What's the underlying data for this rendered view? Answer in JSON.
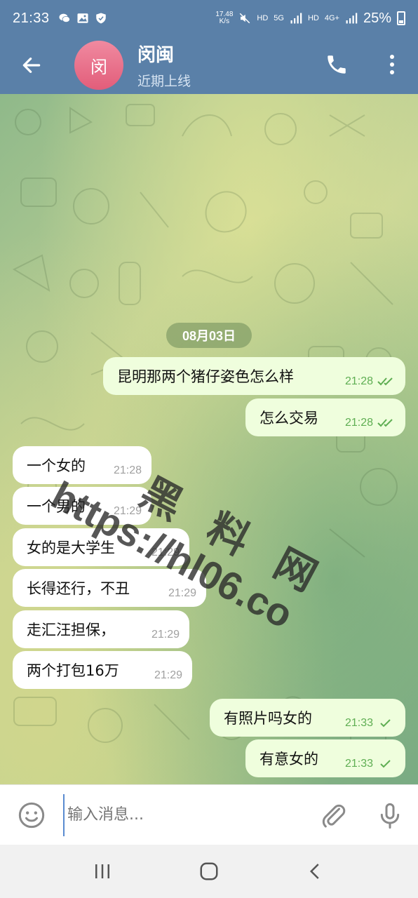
{
  "status_bar": {
    "time": "21:33",
    "speed_value": "17.48",
    "speed_unit": "K/s",
    "hd1": "HD",
    "net1": "5G",
    "hd2": "HD",
    "net2": "4G+",
    "battery": "25%"
  },
  "header": {
    "avatar_letter": "闵",
    "title": "闵闽",
    "subtitle": "近期上线"
  },
  "chat": {
    "date": "08月03日",
    "messages": [
      {
        "dir": "out",
        "text": "昆明那两个猪仔姿色怎么样",
        "time": "21:28",
        "status": "read"
      },
      {
        "dir": "out",
        "text": "怎么交易",
        "time": "21:28",
        "status": "read"
      },
      {
        "dir": "in",
        "text": "一个女的",
        "time": "21:28"
      },
      {
        "dir": "in",
        "text": "一个男的",
        "time": "21:29"
      },
      {
        "dir": "in",
        "text": "女的是大学生",
        "time": "21:29"
      },
      {
        "dir": "in",
        "text": "长得还行，不丑",
        "time": "21:29"
      },
      {
        "dir": "in",
        "text": "走汇汪担保，",
        "time": "21:29"
      },
      {
        "dir": "in",
        "text": "两个打包16万",
        "time": "21:29"
      },
      {
        "dir": "out",
        "text": "有照片吗女的",
        "time": "21:33",
        "status": "sent"
      },
      {
        "dir": "out",
        "text": "有意女的",
        "time": "21:33",
        "status": "sent"
      }
    ]
  },
  "watermark": {
    "cn": "黑料网",
    "url": "https://hl06.co"
  },
  "input": {
    "placeholder": "输入消息..."
  },
  "icons": {
    "back": "arrow-left-icon",
    "call": "phone-icon",
    "more": "more-vert-icon",
    "emoji": "emoji-icon",
    "attach": "paperclip-icon",
    "mic": "microphone-icon"
  },
  "colors": {
    "header": "#5a80a8",
    "outgoing_bubble": "#effedd",
    "incoming_bubble": "#ffffff",
    "read_check": "#5fae53",
    "avatar": "#e56a85"
  }
}
